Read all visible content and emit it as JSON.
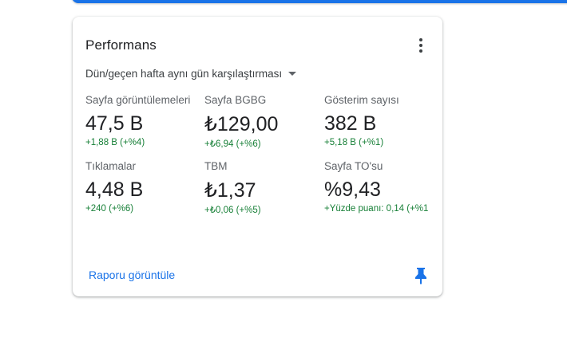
{
  "card": {
    "title": "Performans",
    "comparison_label": "Dün/geçen hafta aynı gün karşılaştırması",
    "report_link": "Raporu görüntüle"
  },
  "metrics": [
    {
      "label": "Sayfa görüntülemeleri",
      "value": "47,5 B",
      "change": "+1,88 B (+%4)"
    },
    {
      "label": "Sayfa BGBG",
      "value": "₺129,00",
      "change": "+₺6,94 (+%6)"
    },
    {
      "label": "Gösterim sayısı",
      "value": "382 B",
      "change": "+5,18 B (+%1)"
    },
    {
      "label": "Tıklamalar",
      "value": "4,48 B",
      "change": "+240 (+%6)"
    },
    {
      "label": "TBM",
      "value": "₺1,37",
      "change": "+₺0,06 (+%5)"
    },
    {
      "label": "Sayfa TO'su",
      "value": "%9,43",
      "change": "+Yüzde puanı: 0,14 (+%1"
    }
  ],
  "colors": {
    "accent": "#1a73e8",
    "positive": "#188038"
  },
  "icons": {
    "more": "more-vert-icon",
    "dropdown": "arrow-drop-down-icon",
    "pin": "pin-icon"
  }
}
